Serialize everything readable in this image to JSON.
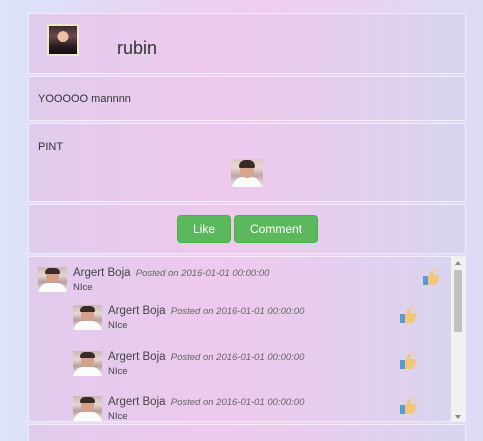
{
  "post": {
    "username": "rubin",
    "text": "YOOOOO mannnn",
    "attachment_label": "PINT"
  },
  "actions": {
    "like_label": "Like",
    "comment_label": "Comment"
  },
  "comments": [
    {
      "author": "Argert Boja",
      "meta": "Posted on 2016-01-01 00:00:00",
      "text": "NIce",
      "reply": false
    },
    {
      "author": "Argert Boja",
      "meta": "Posted on 2016-01-01 00:00:00",
      "text": "NIce",
      "reply": true
    },
    {
      "author": "Argert Boja",
      "meta": "Posted on 2016-01-01 00:00:00",
      "text": "NIce",
      "reply": true
    },
    {
      "author": "Argert Boja",
      "meta": "Posted on 2016-01-01 00:00:00",
      "text": "NIce",
      "reply": true
    }
  ],
  "colors": {
    "button_green": "#5cb85c",
    "thumb_blue": "#5b9bd5",
    "thumb_skin": "#f2c77a"
  },
  "icons": {
    "like_thumb": "thumbs-up-icon"
  }
}
